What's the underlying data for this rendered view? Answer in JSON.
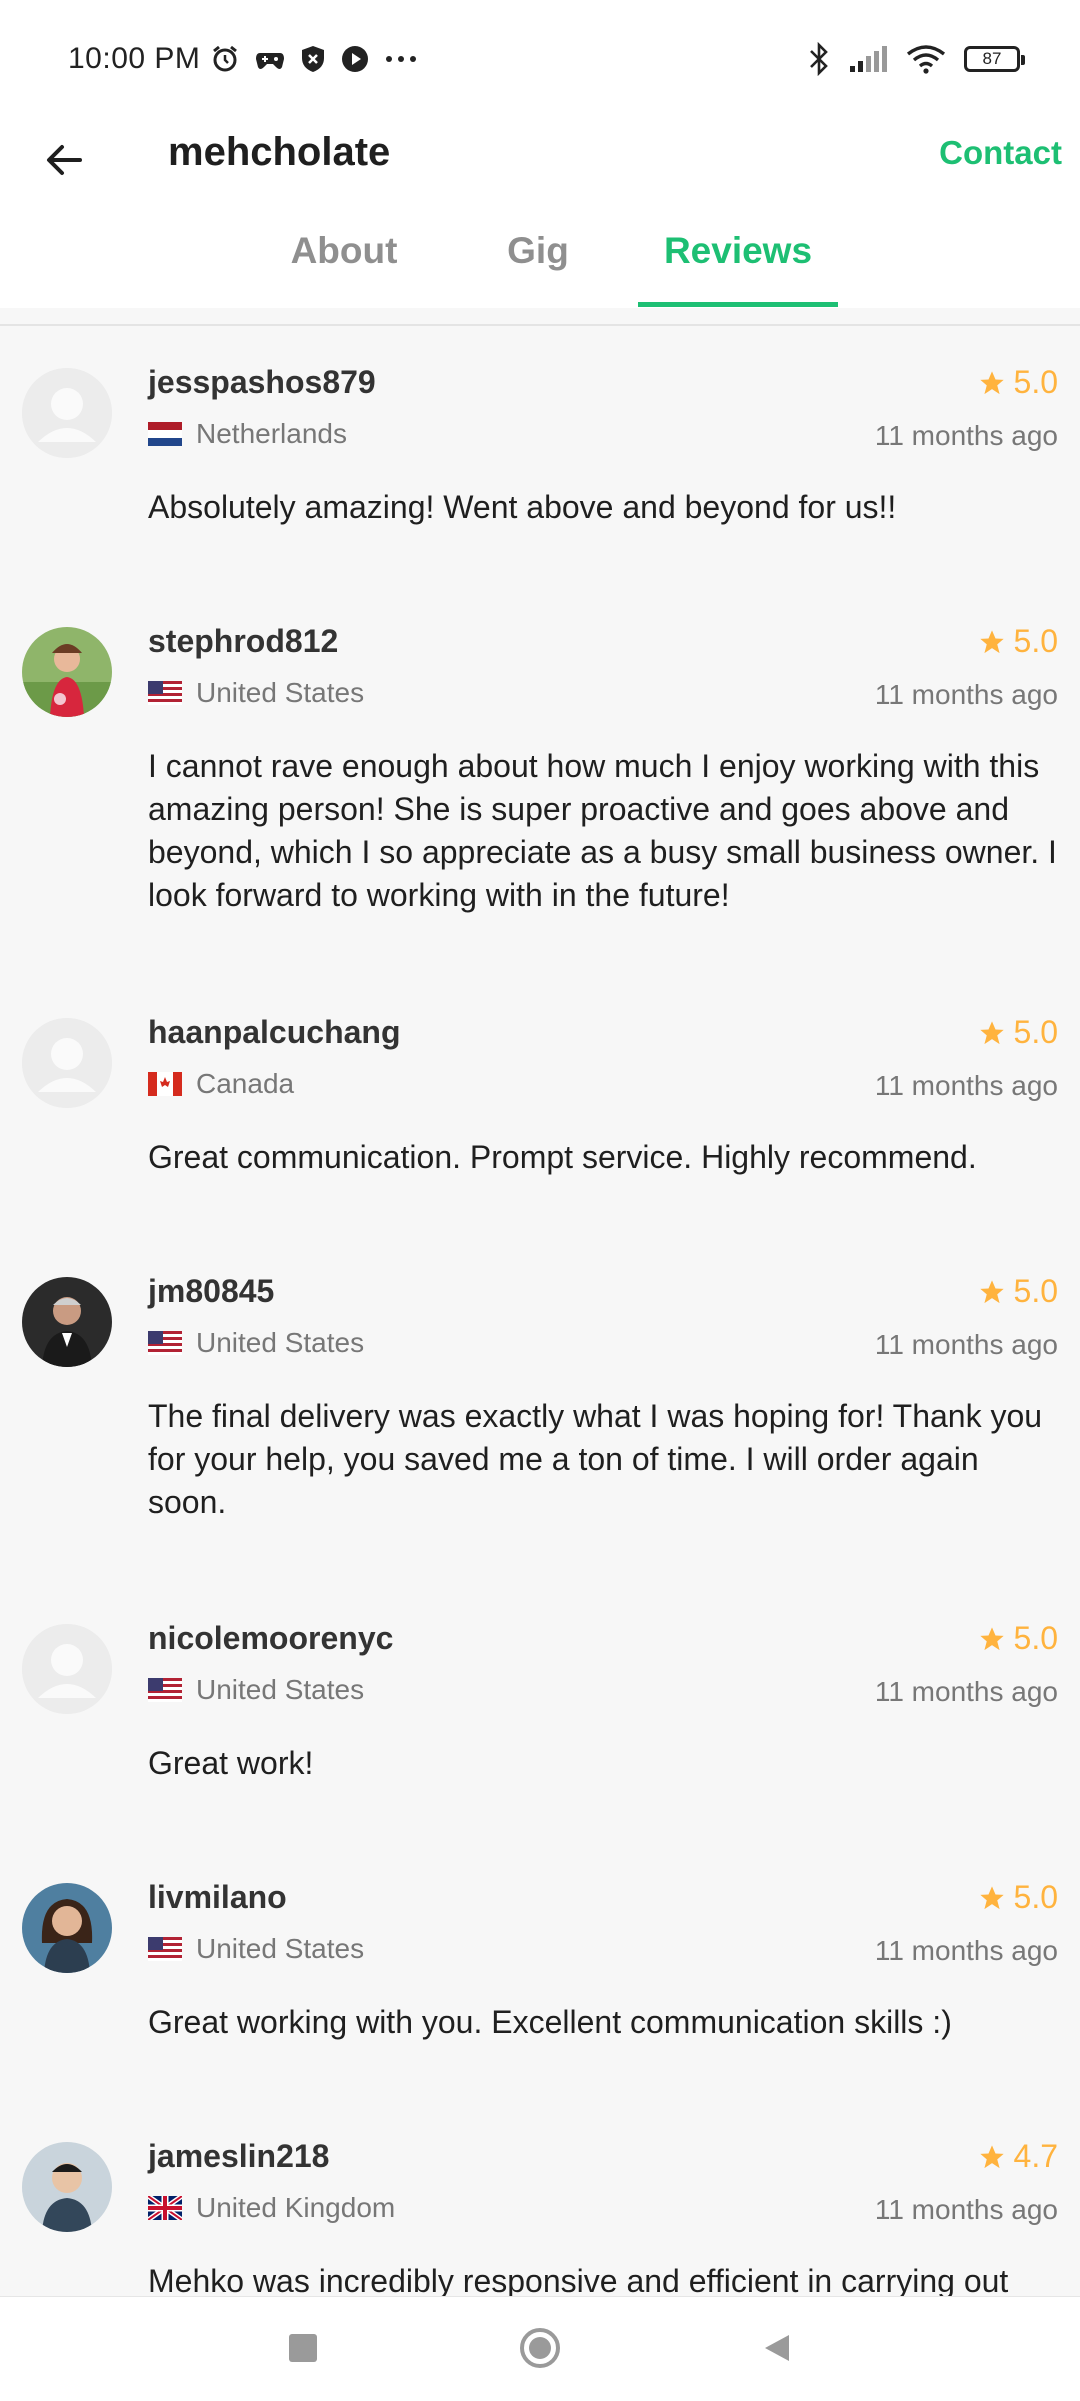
{
  "status_bar": {
    "time": "10:00 PM",
    "icons_left": [
      "alarm-icon",
      "game-controller-icon",
      "shield-icon",
      "media-icon",
      "more-dots-icon"
    ],
    "icons_right": [
      "bluetooth-icon",
      "signal-icon",
      "wifi-icon",
      "battery-icon"
    ],
    "battery_level": "87"
  },
  "header": {
    "title": "mehcholate",
    "contact_label": "Contact",
    "back_icon": "arrow-back-icon"
  },
  "tabs": [
    {
      "label": "About",
      "active": false
    },
    {
      "label": "Gig",
      "active": false
    },
    {
      "label": "Reviews",
      "active": true
    }
  ],
  "colors": {
    "accent": "#1dbf73",
    "star": "#ffb33e",
    "muted": "#777777"
  },
  "reviews": [
    {
      "username": "jesspashos879",
      "country": "Netherlands",
      "rating": "5.0",
      "time_ago": "11 months ago",
      "text": "Absolutely amazing! Went above and beyond for us!!",
      "avatar": "default-avatar"
    },
    {
      "username": "stephrod812",
      "country": "United States",
      "rating": "5.0",
      "time_ago": "11 months ago",
      "text": "I cannot rave enough about how much I enjoy working with this amazing person! She is super proactive and goes above and beyond, which I so appreciate as a busy small business owner. I look forward to working with in the future!",
      "avatar": "photo-avatar"
    },
    {
      "username": "haanpalcuchang",
      "country": "Canada",
      "rating": "5.0",
      "time_ago": "11 months ago",
      "text": "Great communication. Prompt service. Highly recommend.",
      "avatar": "default-avatar"
    },
    {
      "username": "jm80845",
      "country": "United States",
      "rating": "5.0",
      "time_ago": "11 months ago",
      "text": "The final delivery was exactly what I was hoping for! Thank you for your help, you saved me a ton of time. I will order again soon.",
      "avatar": "photo-avatar"
    },
    {
      "username": "nicolemoorenyc",
      "country": "United States",
      "rating": "5.0",
      "time_ago": "11 months ago",
      "text": "Great work!",
      "avatar": "default-avatar"
    },
    {
      "username": "livmilano",
      "country": "United States",
      "rating": "5.0",
      "time_ago": "11 months ago",
      "text": "Great working with you. Excellent communication skills :)",
      "avatar": "photo-avatar"
    },
    {
      "username": "jameslin218",
      "country": "United Kingdom",
      "rating": "4.7",
      "time_ago": "11 months ago",
      "text": "Mehko was incredibly responsive and efficient in carrying out",
      "avatar": "photo-avatar"
    }
  ],
  "nav_bar": {
    "buttons": [
      "recents-square-icon",
      "home-circle-icon",
      "back-triangle-icon"
    ]
  }
}
